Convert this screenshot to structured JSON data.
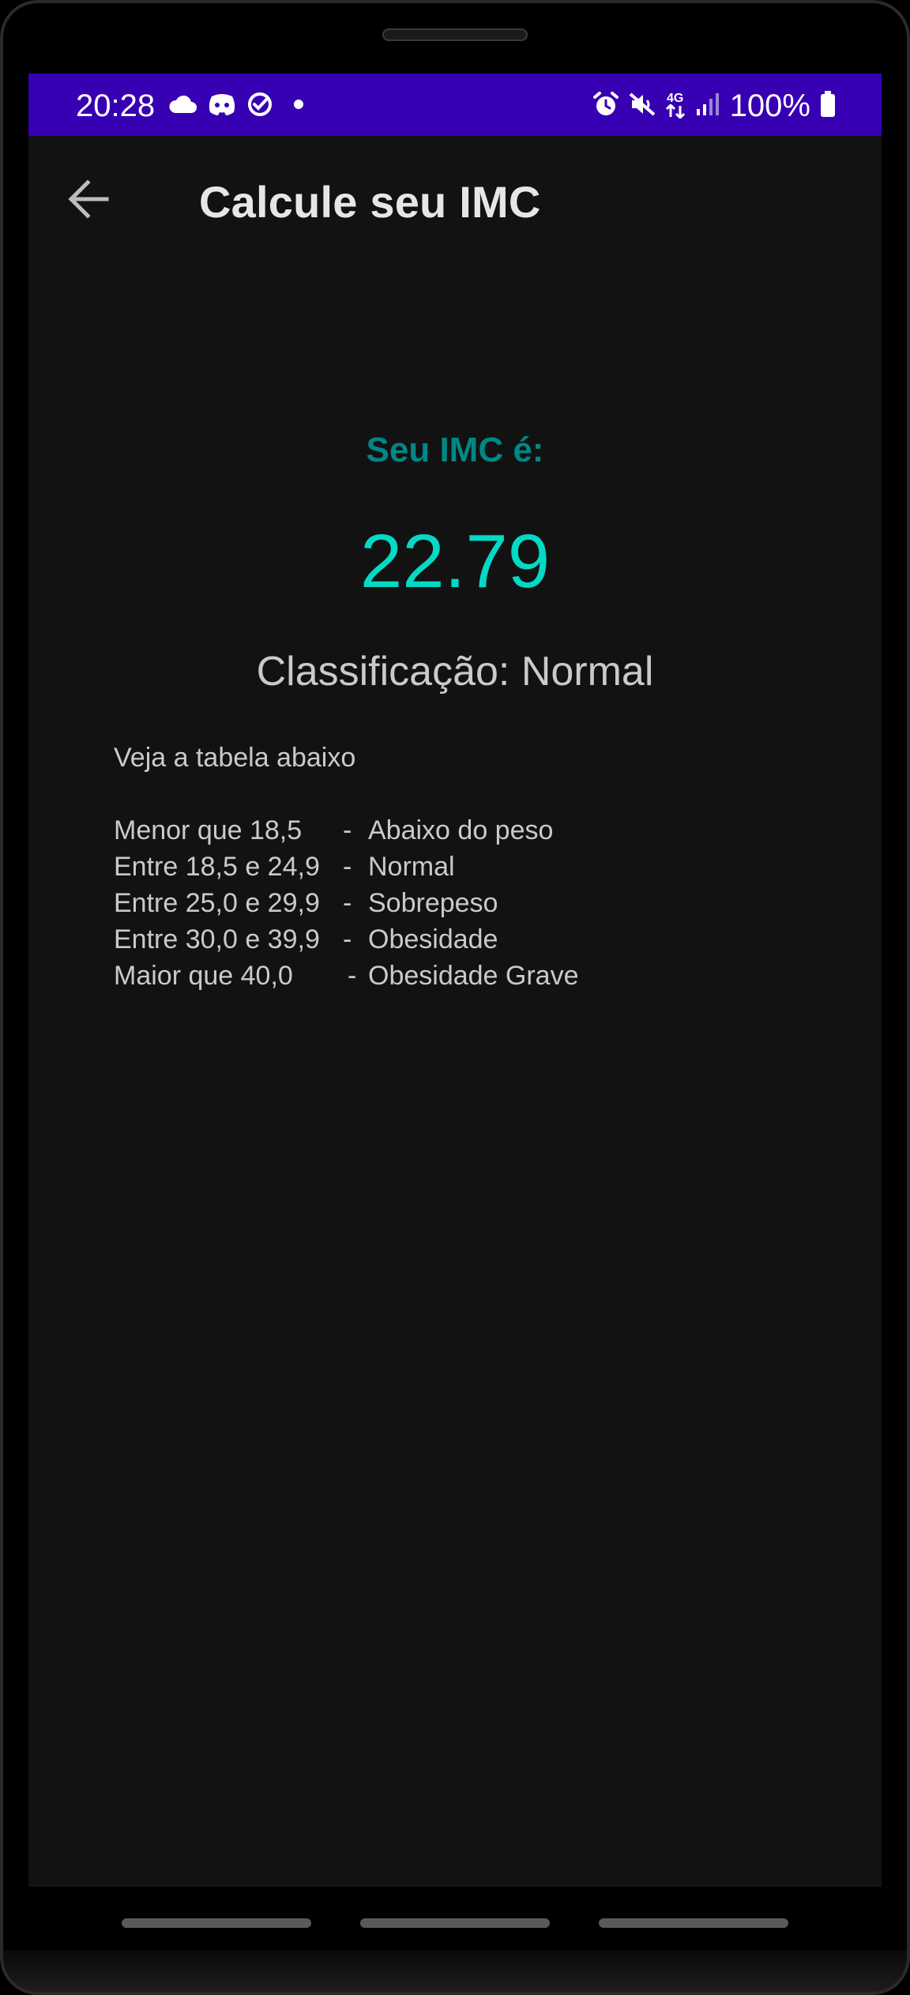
{
  "status_bar": {
    "time": "20:28",
    "left_icons": [
      "cloud-icon",
      "discord-icon",
      "check-circle-icon",
      "dot-icon"
    ],
    "right_icons": [
      "alarm-icon",
      "mute-icon",
      "network-4g-icon",
      "signal-icon"
    ],
    "network_label": "4G",
    "battery_text": "100%",
    "background_color": "#3700B3"
  },
  "app_bar": {
    "title": "Calcule seu IMC",
    "back_icon": "arrow-back-icon"
  },
  "result": {
    "label": "Seu IMC é:",
    "value": "22.79",
    "classification": "Classificação: Normal",
    "label_color": "#018786",
    "value_color": "#03DAC5"
  },
  "reference_table": {
    "intro": "Veja a tabela abaixo",
    "rows": [
      {
        "range": "Menor que 18,5",
        "separator": "-",
        "classification": "Abaixo do peso"
      },
      {
        "range": "Entre 18,5 e 24,9",
        "separator": "-",
        "classification": "Normal"
      },
      {
        "range": "Entre 25,0 e 29,9",
        "separator": "-",
        "classification": "Sobrepeso"
      },
      {
        "range": "Entre 30,0 e 39,9",
        "separator": "-",
        "classification": "Obesidade"
      },
      {
        "range": "Maior que 40,0",
        "separator": "-",
        "classification": "Obesidade Grave"
      }
    ]
  }
}
